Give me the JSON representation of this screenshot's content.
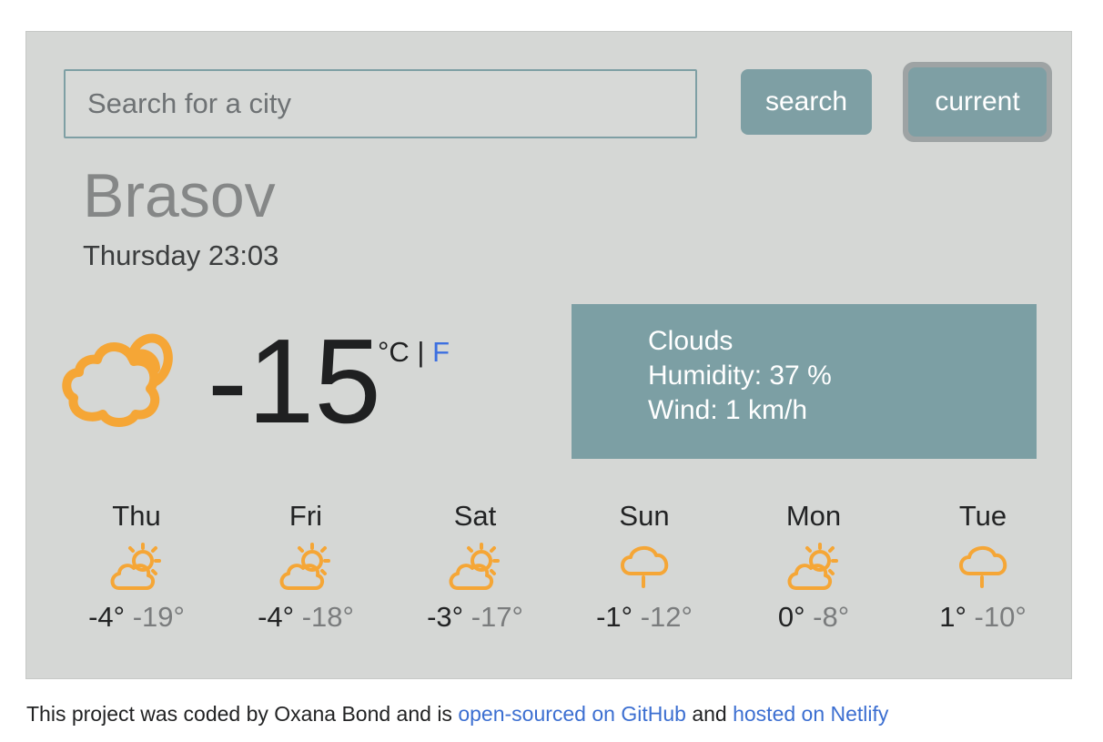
{
  "search": {
    "placeholder": "Search for a city",
    "value": ""
  },
  "buttons": {
    "search_label": "search",
    "current_label": "current"
  },
  "city": "Brasov",
  "datetime": "Thursday 23:03",
  "current": {
    "temperature": "-15",
    "unit_c": "°C",
    "unit_sep": "|",
    "unit_f": "F",
    "icon": "cloud-sun-icon",
    "description": "Clouds",
    "humidity": "Humidity: 37 %",
    "wind": "Wind: 1 km/h"
  },
  "forecast": [
    {
      "day": "Thu",
      "icon": "partly-sunny-icon",
      "max": "-4°",
      "min": "-19°"
    },
    {
      "day": "Fri",
      "icon": "partly-sunny-icon",
      "max": "-4°",
      "min": "-18°"
    },
    {
      "day": "Sat",
      "icon": "partly-sunny-icon",
      "max": "-3°",
      "min": "-17°"
    },
    {
      "day": "Sun",
      "icon": "cloud-rain-icon",
      "max": "-1°",
      "min": "-12°"
    },
    {
      "day": "Mon",
      "icon": "partly-sunny-icon",
      "max": "0°",
      "min": "-8°"
    },
    {
      "day": "Tue",
      "icon": "cloud-rain-icon",
      "max": "1°",
      "min": "-10°"
    }
  ],
  "footer": {
    "text_before": "This project was coded by Oxana Bond and is ",
    "github_link": "open-sourced on GitHub",
    "text_middle": " and ",
    "netlify_link": "hosted on Netlify"
  },
  "colors": {
    "panel_bg": "#d5d7d5",
    "accent": "#7e9fa4",
    "icon_orange": "#f5a636",
    "link_blue": "#3c6fd1"
  }
}
